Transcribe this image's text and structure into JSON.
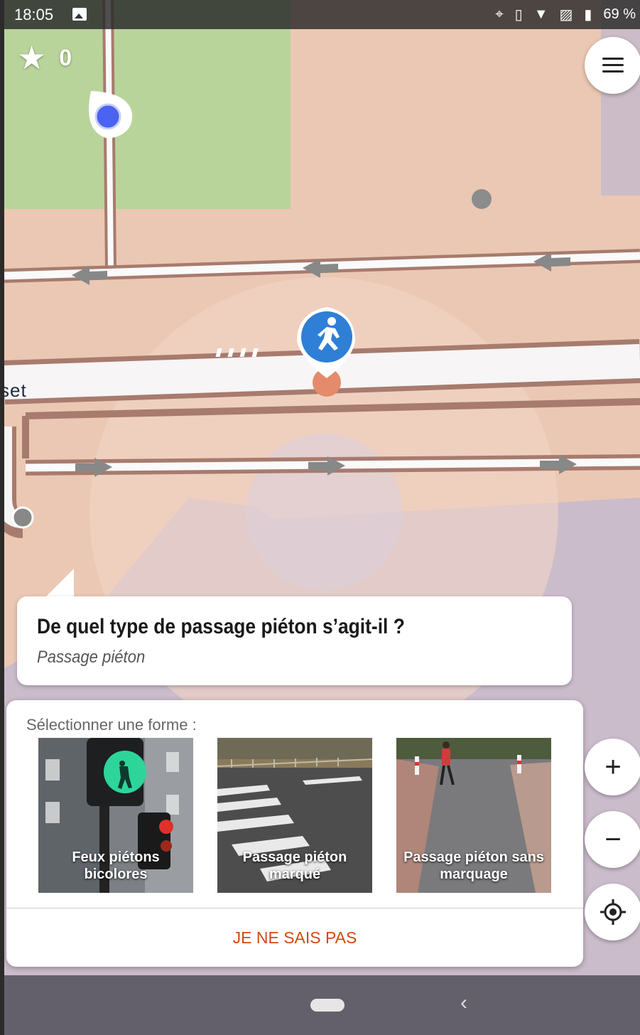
{
  "status_bar": {
    "time": "18:05",
    "battery": "69 %"
  },
  "counter": {
    "star_symbol": "★",
    "value": "0"
  },
  "map": {
    "street_label": "set"
  },
  "quest": {
    "question": "De quel type de passage piéton s’agit-il ?",
    "subtitle": "Passage piéton"
  },
  "panel": {
    "select_label": "Sélectionner une forme :",
    "options": [
      {
        "label": "Feux piétons bicolores"
      },
      {
        "label": "Passage piéton marqué"
      },
      {
        "label": "Passage piéton sans marquage"
      }
    ],
    "dunno_label": "JE NE SAIS PAS"
  },
  "controls": {
    "zoom_in": "+",
    "zoom_out": "−"
  },
  "colors": {
    "accent": "#d14a13",
    "pin": "#4a63f0",
    "crossing_icon": "#2f7fd6"
  }
}
